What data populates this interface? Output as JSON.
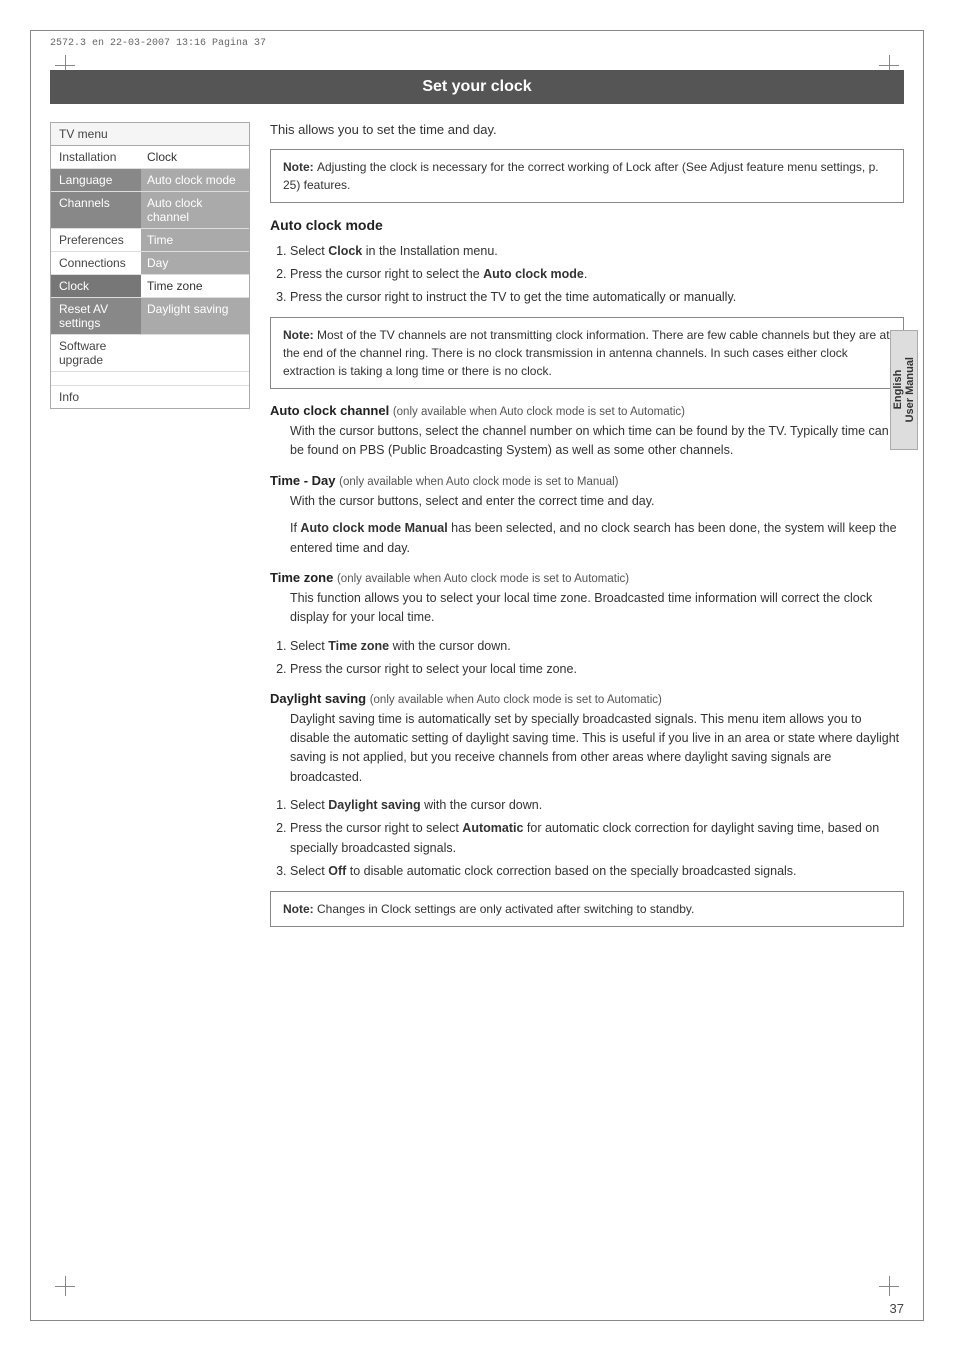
{
  "printHeader": "2572.3 en  22-03-2007   13:16   Pagina 37",
  "pageTitle": "Set your clock",
  "introText": "This allows you to set the time and day.",
  "noteBox1": {
    "label": "Note:",
    "text": "Adjusting the clock is necessary for the correct working of Lock after (See Adjust feature menu settings, p. 25) features."
  },
  "menu": {
    "header": "TV menu",
    "rows": [
      {
        "left": "Installation",
        "right": "Clock",
        "state": "clock-selected"
      },
      {
        "left": "Language",
        "right": "Auto clock mode",
        "state": "highlighted"
      },
      {
        "left": "Channels",
        "right": "Auto clock channel",
        "state": "highlighted"
      },
      {
        "left": "Preferences",
        "right": "Time",
        "state": "right-only"
      },
      {
        "left": "Connections",
        "right": "Day",
        "state": "right-only"
      },
      {
        "left": "Clock",
        "right": "Time zone",
        "state": "left-only"
      },
      {
        "left": "Reset AV settings",
        "right": "Daylight saving",
        "state": "active"
      },
      {
        "left": "Software upgrade",
        "right": "",
        "state": "normal"
      }
    ],
    "info": "Info"
  },
  "sections": [
    {
      "id": "auto-clock-mode",
      "heading": "Auto clock mode",
      "steps": [
        "Select <b>Clock</b> in the Installation menu.",
        "Press the cursor right to select the <b>Auto clock mode</b>.",
        "Press the cursor right to instruct the TV to get the time automatically or manually."
      ],
      "note": {
        "label": "Note:",
        "text": "Most of the TV channels are not transmitting clock information. There are few cable channels but they are at the end of the channel ring. There is no clock transmission in antenna channels. In such cases either clock extraction is taking a long time or there is no clock."
      }
    },
    {
      "id": "auto-clock-channel",
      "heading": "Auto clock channel",
      "subNote": "(only available when Auto clock mode is set to Automatic)",
      "text": "With the cursor buttons, select the channel number on which time can be found by the TV. Typically time can be found on PBS (Public Broadcasting System) as well as some other channels."
    },
    {
      "id": "time-day",
      "heading": "Time - Day",
      "subNote": "(only available when Auto clock mode is set to Manual)",
      "text1": "With the cursor buttons, select and enter the correct time and day.",
      "text2": "If <b>Auto clock mode Manual</b> has been selected, and no clock search has been done, the system will keep the entered time and day."
    },
    {
      "id": "time-zone",
      "heading": "Time zone",
      "subNote": "(only available when Auto clock mode is set to Automatic)",
      "intro": "This function allows you to select your local time zone. Broadcasted time information will correct the clock display for your local time.",
      "steps": [
        "Select <b>Time zone</b> with the cursor down.",
        "Press the cursor right to select your local time zone."
      ]
    },
    {
      "id": "daylight-saving",
      "heading": "Daylight saving",
      "subNote": "(only available when Auto clock mode is set to Automatic)",
      "intro": "Daylight saving time is automatically set by specially broadcasted signals. This menu item allows you to disable the automatic setting of daylight saving time. This is useful if you live in an area or state where daylight saving is not applied, but you receive channels from other areas where daylight saving signals are broadcasted.",
      "steps": [
        "Select <b>Daylight saving</b> with the cursor down.",
        "Press the cursor right to select <b>Automatic</b> for automatic clock correction for daylight saving time, based on specially broadcasted signals.",
        "Select <b>Off</b> to disable automatic clock correction based on the specially broadcasted signals."
      ]
    }
  ],
  "noteBox2": {
    "label": "Note:",
    "text": "Changes in Clock settings are only activated after switching to standby."
  },
  "sideTab": {
    "line1": "English",
    "line2": "User Manual"
  },
  "pageNumber": "37"
}
